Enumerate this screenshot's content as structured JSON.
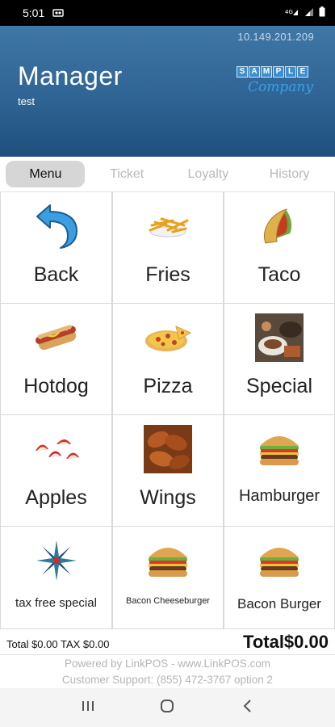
{
  "status_bar": {
    "time": "5:01",
    "left_icon": "cast-icon",
    "right_icons": [
      "wifi-4g-icon",
      "signal-icon",
      "battery-icon"
    ]
  },
  "header": {
    "ip_address": "10.149.201.209",
    "title": "Manager",
    "subtitle": "test",
    "logo": {
      "letters": [
        "S",
        "A",
        "M",
        "P",
        "L",
        "E"
      ],
      "script": "Company"
    }
  },
  "tabs": [
    {
      "label": "Menu",
      "active": true
    },
    {
      "label": "Ticket",
      "active": false
    },
    {
      "label": "Loyalty",
      "active": false
    },
    {
      "label": "History",
      "active": false
    }
  ],
  "menu_items": [
    {
      "label": "Back",
      "icon": "back-arrow-icon"
    },
    {
      "label": "Fries",
      "icon": "fries-icon"
    },
    {
      "label": "Taco",
      "icon": "taco-icon"
    },
    {
      "label": "Hotdog",
      "icon": "hotdog-icon"
    },
    {
      "label": "Pizza",
      "icon": "pizza-icon"
    },
    {
      "label": "Special",
      "icon": "special-plate-icon"
    },
    {
      "label": "Apples",
      "icon": "apples-icon"
    },
    {
      "label": "Wings",
      "icon": "wings-icon"
    },
    {
      "label": "Hamburger",
      "icon": "hamburger-icon"
    },
    {
      "label": "tax free special",
      "icon": "star-burst-icon"
    },
    {
      "label": "Bacon Cheeseburger",
      "icon": "hamburger-icon"
    },
    {
      "label": "Bacon Burger",
      "icon": "hamburger-icon"
    }
  ],
  "totals": {
    "summary": "Total $0.00 TAX $0.00",
    "grand_total": "Total$0.00"
  },
  "footer": {
    "powered_by": "Powered by LinkPOS - www.LinkPOS.com",
    "support": "Customer Support: (855) 472-3767 option 2"
  },
  "colors": {
    "header_top": "#3f77a6",
    "header_bottom": "#1f4f7d",
    "active_tab": "#d6d6d6",
    "back_arrow": "#3b9ee2"
  }
}
